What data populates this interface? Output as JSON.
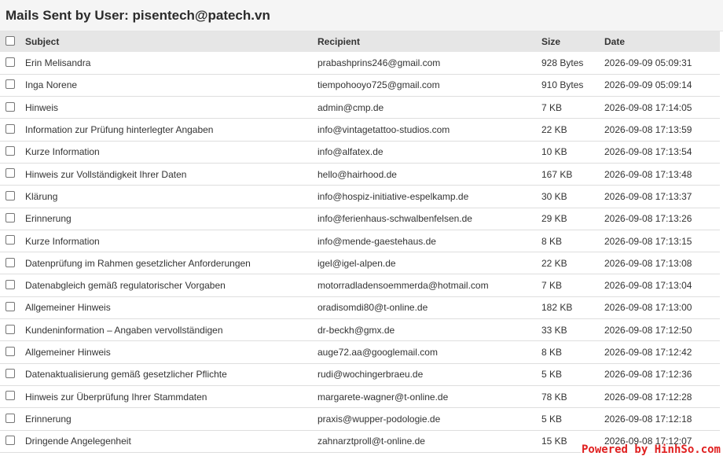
{
  "page": {
    "title": "Mails Sent by User: pisentech@patech.vn"
  },
  "table": {
    "columns": {
      "subject": "Subject",
      "recipient": "Recipient",
      "size": "Size",
      "date": "Date"
    },
    "rows": [
      {
        "subject": "Erin Melisandra",
        "recipient": "prabashprins246@gmail.com",
        "size": "928 Bytes",
        "date": "2026-09-09 05:09:31"
      },
      {
        "subject": "Inga Norene",
        "recipient": "tiempohooyo725@gmail.com",
        "size": "910 Bytes",
        "date": "2026-09-09 05:09:14"
      },
      {
        "subject": "Hinweis",
        "recipient": "admin@cmp.de",
        "size": "7 KB",
        "date": "2026-09-08 17:14:05"
      },
      {
        "subject": "Information zur Prüfung hinterlegter Angaben",
        "recipient": "info@vintagetattoo-studios.com",
        "size": "22 KB",
        "date": "2026-09-08 17:13:59"
      },
      {
        "subject": "Kurze Information",
        "recipient": "info@alfatex.de",
        "size": "10 KB",
        "date": "2026-09-08 17:13:54"
      },
      {
        "subject": "Hinweis zur Vollständigkeit Ihrer Daten",
        "recipient": "hello@hairhood.de",
        "size": "167 KB",
        "date": "2026-09-08 17:13:48"
      },
      {
        "subject": "Klärung",
        "recipient": "info@hospiz-initiative-espelkamp.de",
        "size": "30 KB",
        "date": "2026-09-08 17:13:37"
      },
      {
        "subject": "Erinnerung",
        "recipient": "info@ferienhaus-schwalbenfelsen.de",
        "size": "29 KB",
        "date": "2026-09-08 17:13:26"
      },
      {
        "subject": "Kurze Information",
        "recipient": "info@mende-gaestehaus.de",
        "size": "8 KB",
        "date": "2026-09-08 17:13:15"
      },
      {
        "subject": "Datenprüfung im Rahmen gesetzlicher Anforderungen",
        "recipient": "igel@igel-alpen.de",
        "size": "22 KB",
        "date": "2026-09-08 17:13:08"
      },
      {
        "subject": "Datenabgleich gemäß regulatorischer Vorgaben",
        "recipient": "motorradladensoemmerda@hotmail.com",
        "size": "7 KB",
        "date": "2026-09-08 17:13:04"
      },
      {
        "subject": "Allgemeiner Hinweis",
        "recipient": "oradisomdi80@t-online.de",
        "size": "182 KB",
        "date": "2026-09-08 17:13:00"
      },
      {
        "subject": "Kundeninformation – Angaben vervollständigen",
        "recipient": "dr-beckh@gmx.de",
        "size": "33 KB",
        "date": "2026-09-08 17:12:50"
      },
      {
        "subject": "Allgemeiner Hinweis",
        "recipient": "auge72.aa@googlemail.com",
        "size": "8 KB",
        "date": "2026-09-08 17:12:42"
      },
      {
        "subject": "Datenaktualisierung gemäß gesetzlicher Pflichte",
        "recipient": "rudi@wochingerbraeu.de",
        "size": "5 KB",
        "date": "2026-09-08 17:12:36"
      },
      {
        "subject": "Hinweis zur Überprüfung Ihrer Stammdaten",
        "recipient": "margarete-wagner@t-online.de",
        "size": "78 KB",
        "date": "2026-09-08 17:12:28"
      },
      {
        "subject": "Erinnerung",
        "recipient": "praxis@wupper-podologie.de",
        "size": "5 KB",
        "date": "2026-09-08 17:12:18"
      },
      {
        "subject": "Dringende Angelegenheit",
        "recipient": "zahnarztproll@t-online.de",
        "size": "15 KB",
        "date": "2026-09-08 17:12:07"
      }
    ]
  },
  "watermark": "Powered by HinhSo.com"
}
